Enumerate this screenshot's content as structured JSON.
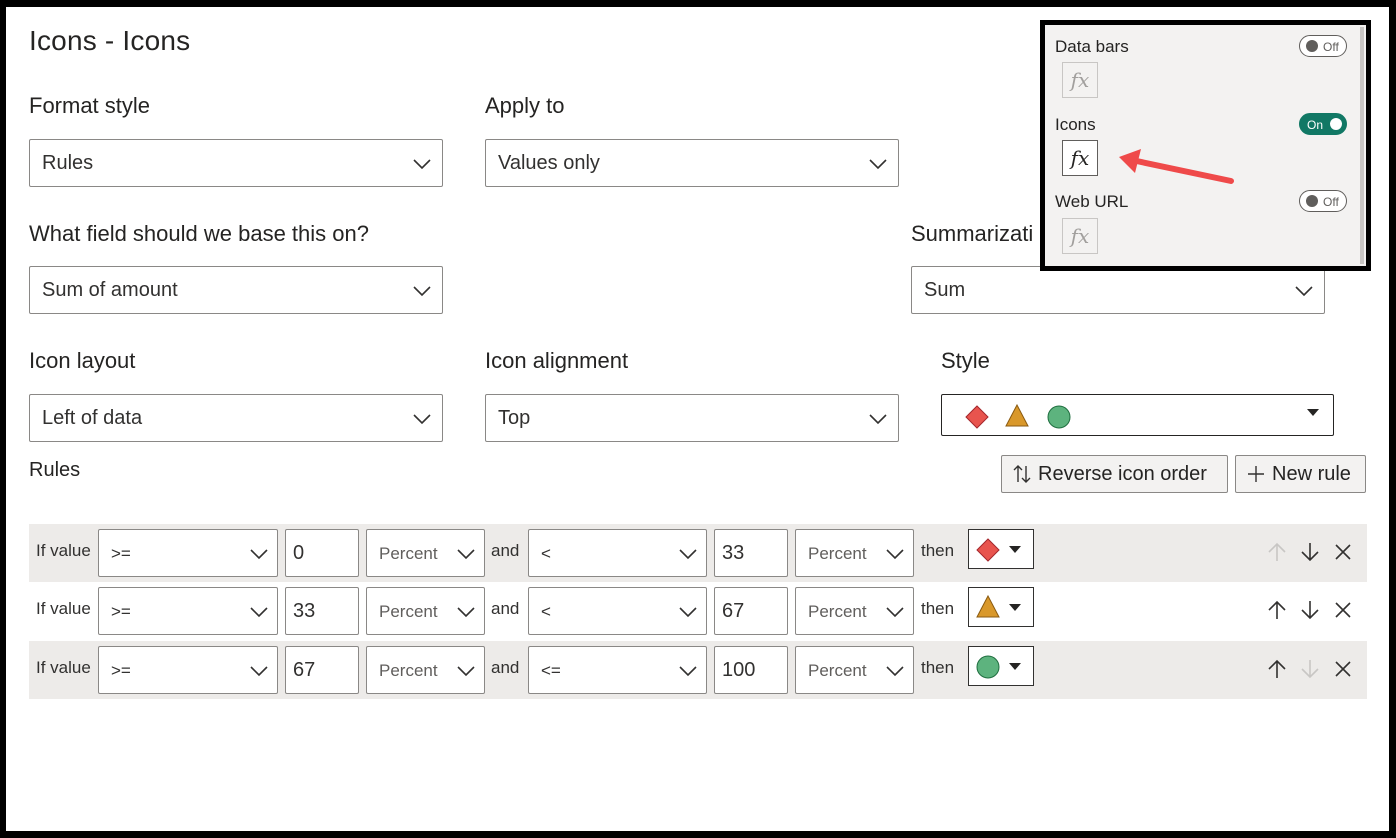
{
  "dialog": {
    "title": "Icons - Icons"
  },
  "fields": {
    "format_style": {
      "label": "Format style",
      "value": "Rules"
    },
    "apply_to": {
      "label": "Apply to",
      "value": "Values only"
    },
    "base_field": {
      "label": "What field should we base this on?",
      "value": "Sum of amount"
    },
    "summarization": {
      "label": "Summarizati",
      "value": "Sum"
    },
    "icon_layout": {
      "label": "Icon layout",
      "value": "Left of data"
    },
    "icon_alignment": {
      "label": "Icon alignment",
      "value": "Top"
    },
    "style": {
      "label": "Style",
      "icons": [
        "red-diamond-icon",
        "yellow-triangle-icon",
        "green-circle-icon"
      ]
    }
  },
  "rules_section": {
    "label": "Rules",
    "reverse_button": "Reverse icon order",
    "new_rule_button": "New rule"
  },
  "rules": [
    {
      "if": "If value",
      "op1": ">=",
      "v1": "0",
      "type1": "Percent",
      "and": "and",
      "op2": "<",
      "v2": "33",
      "type2": "Percent",
      "then": "then",
      "icon": "red-diamond-icon",
      "up_enabled": false,
      "down_enabled": true
    },
    {
      "if": "If value",
      "op1": ">=",
      "v1": "33",
      "type1": "Percent",
      "and": "and",
      "op2": "<",
      "v2": "67",
      "type2": "Percent",
      "then": "then",
      "icon": "yellow-triangle-icon",
      "up_enabled": true,
      "down_enabled": true
    },
    {
      "if": "If value",
      "op1": ">=",
      "v1": "67",
      "type1": "Percent",
      "and": "and",
      "op2": "<=",
      "v2": "100",
      "type2": "Percent",
      "then": "then",
      "icon": "green-circle-icon",
      "up_enabled": true,
      "down_enabled": false
    }
  ],
  "popup": {
    "data_bars": {
      "label": "Data bars",
      "toggle": "Off"
    },
    "icons": {
      "label": "Icons",
      "toggle": "On"
    },
    "web_url": {
      "label": "Web URL",
      "toggle": "Off"
    },
    "fx": "fx"
  },
  "colors": {
    "diamond": "#e8544e",
    "triangle": "#d9982b",
    "circle": "#5db37e",
    "toggle_on": "#117865",
    "arrow": "#ef4a4a"
  }
}
